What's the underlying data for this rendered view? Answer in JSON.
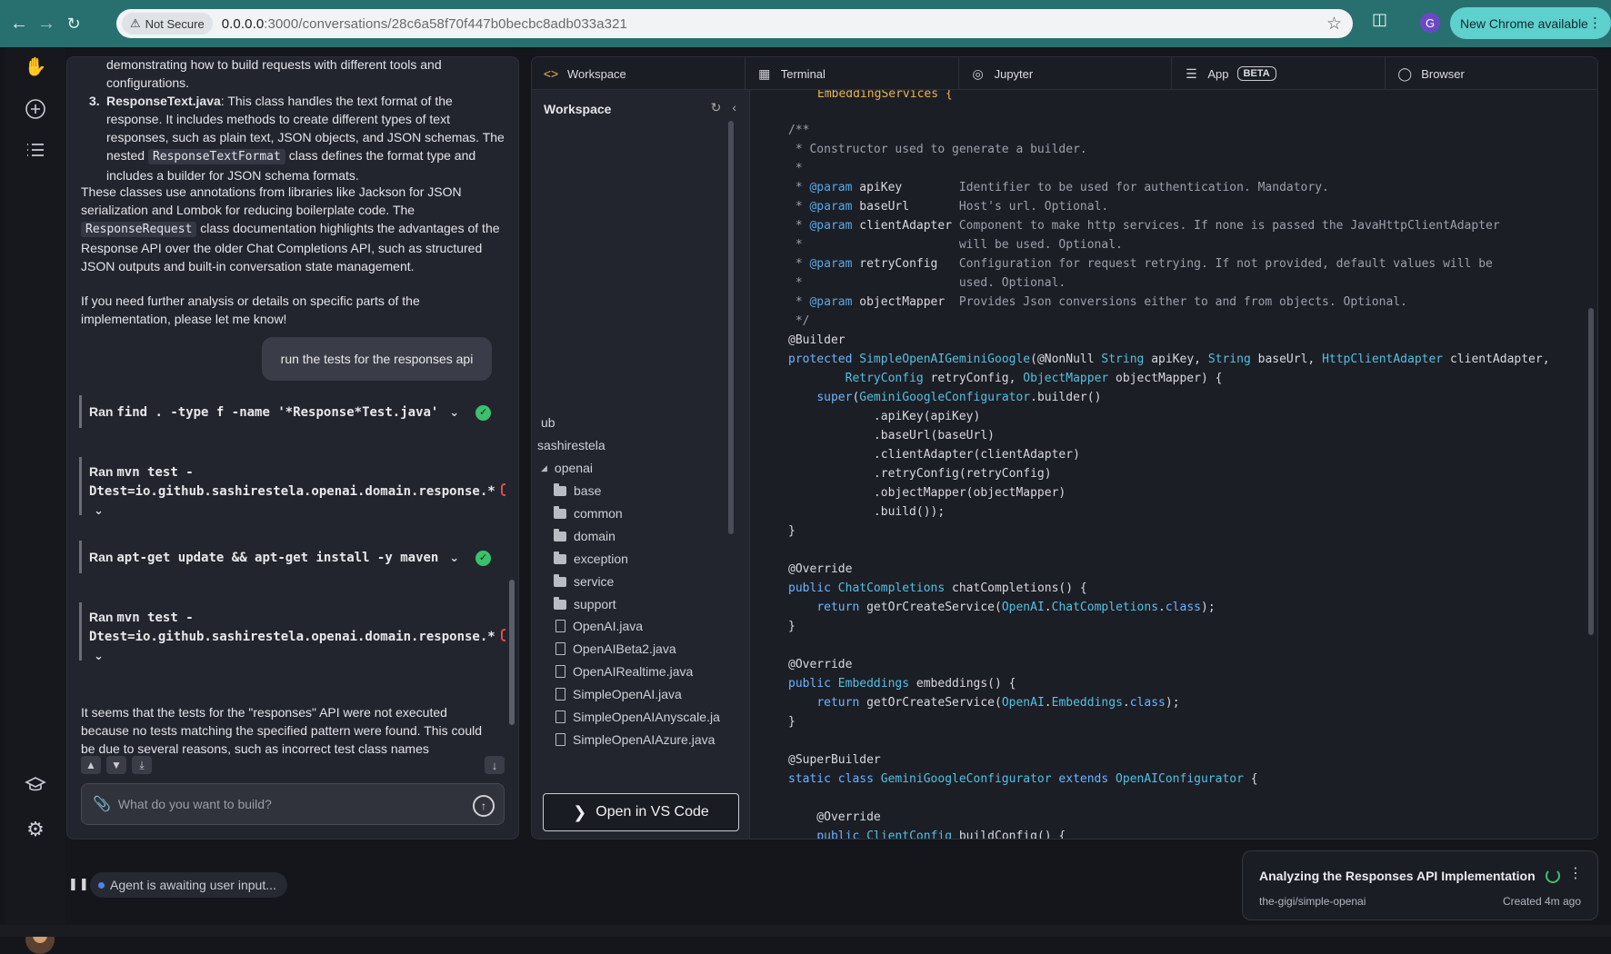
{
  "browser": {
    "not_secure": "Not Secure",
    "url_host": "0.0.0.0",
    "url_rest": ":3000/conversations/28c6a58f70f447b0becbc8adb033a321",
    "profile_initial": "G",
    "update_label": "New Chrome available"
  },
  "chat": {
    "msg_1": "demonstrating how to build requests with different tools and configurations.",
    "item3_num": "3.",
    "item3_title": "ResponseText.java",
    "item3_text_a": ": This class handles the text format of the response. It includes methods to create different types of text responses, such as plain text, JSON objects, and JSON schemas. The nested ",
    "item3_code": "ResponseTextFormat",
    "item3_text_b": " class defines the format type and includes a builder for JSON schema formats.",
    "para_a": "These classes use annotations from libraries like Jackson for JSON serialization and Lombok for reducing boilerplate code. The ",
    "para_code": "ResponseRequest",
    "para_b": " class documentation highlights the advantages of the Response API over the older Chat Completions API, such as structured JSON outputs and built-in conversation state management.",
    "para_2": "If you need further analysis or details on specific parts of the implementation, please let me know!",
    "user_msg": "run the tests for the responses api",
    "ran_label": "Ran",
    "ran_1": "find . -type f -name '*Response*Test.java'",
    "ran_2a": "mvn test -",
    "ran_2b": "Dtest=io.github.sashirestela.openai.domain.response.*",
    "ran_3": "apt-get update && apt-get install -y maven",
    "ran_4a": "mvn test -",
    "ran_4b": "Dtest=io.github.sashirestela.openai.domain.response.*",
    "final_msg": "It seems that the tests for the \"responses\" API were not executed because no tests matching the specified pattern were found. This could be due to several reasons, such as incorrect test class names",
    "composer_placeholder": "What do you want to build?"
  },
  "status": {
    "agent": "Agent is awaiting user input..."
  },
  "workspace": {
    "tabs": [
      {
        "label": "Workspace",
        "icon": "code-icon"
      },
      {
        "label": "Terminal",
        "icon": "terminal-icon"
      },
      {
        "label": "Jupyter",
        "icon": "jupyter-icon"
      },
      {
        "label": "App",
        "icon": "app-icon",
        "badge": "BETA"
      },
      {
        "label": "Browser",
        "icon": "globe-icon"
      }
    ],
    "tree_title": "Workspace",
    "tree": {
      "ub": "ub",
      "sashirestela": "sashirestela",
      "openai": "openai",
      "folders": [
        "base",
        "common",
        "domain",
        "exception",
        "service",
        "support"
      ],
      "files": [
        "OpenAI.java",
        "OpenAIBeta2.java",
        "OpenAIRealtime.java",
        "SimpleOpenAI.java",
        "SimpleOpenAIAnyscale.ja",
        "SimpleOpenAIAzure.java"
      ]
    },
    "vscode_label": "Open in VS Code"
  },
  "task": {
    "title": "Analyzing the Responses API Implementation",
    "repo": "the-gigi/simple-openai",
    "created": "Created 4m ago"
  },
  "colors": {
    "accent_teal": "#28706f",
    "success_green": "#3bc16d",
    "tab_active_icon": "#e6b450"
  }
}
